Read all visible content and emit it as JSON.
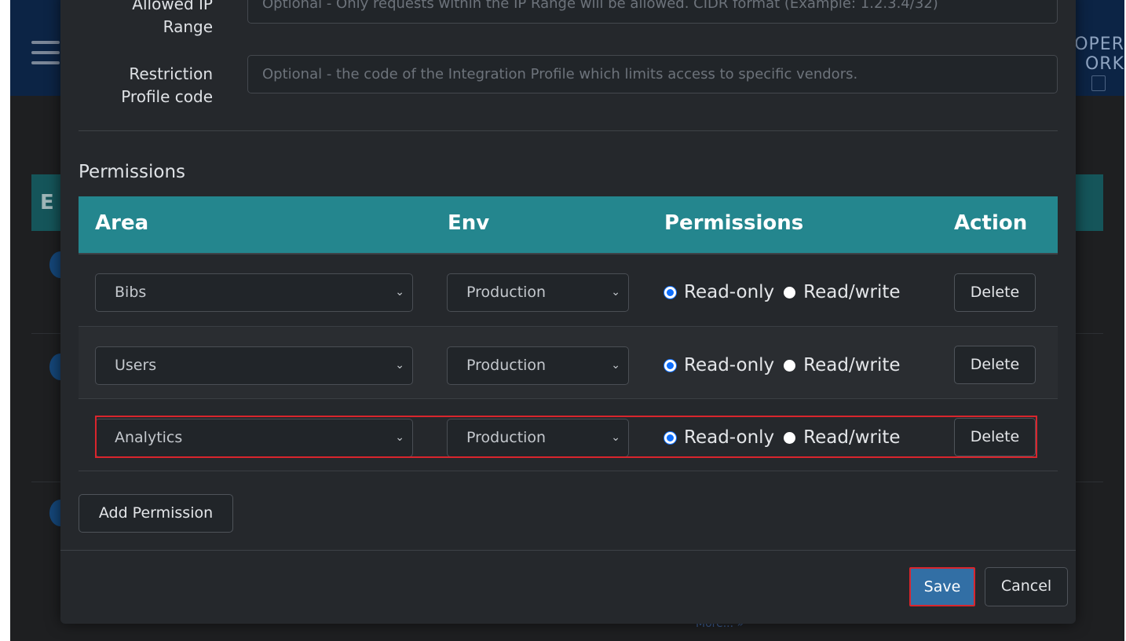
{
  "background": {
    "brand_line1": "OPER",
    "brand_line2": "ORK",
    "section_letter": "E",
    "more_link": "More... »"
  },
  "form": {
    "ip_label_top": "Allowed IP",
    "ip_label_bottom": "Range",
    "ip_placeholder": "Optional - Only requests within the IP Range will be allowed. CIDR format (Example: 1.2.3.4/32)",
    "restriction_label_top": "Restriction",
    "restriction_label_bottom": "Profile code",
    "restriction_placeholder": "Optional - the code of the Integration Profile which limits access to specific vendors."
  },
  "permissions": {
    "heading": "Permissions",
    "columns": [
      "Area",
      "Env",
      "Permissions",
      "Action"
    ],
    "rows": [
      {
        "area": "Bibs",
        "env": "Production",
        "selected": "Read-only"
      },
      {
        "area": "Users",
        "env": "Production",
        "selected": "Read-only"
      },
      {
        "area": "Analytics",
        "env": "Production",
        "selected": "Read-only"
      }
    ],
    "radio_read_only": "Read-only",
    "radio_read_write": "Read/write",
    "delete_label": "Delete",
    "add_label": "Add Permission"
  },
  "footer": {
    "save_label": "Save",
    "cancel_label": "Cancel"
  },
  "colors": {
    "table_header": "#24868e",
    "save_button": "#326fa5",
    "highlight": "#d9252d",
    "radio_selected": "#0d6efd"
  }
}
